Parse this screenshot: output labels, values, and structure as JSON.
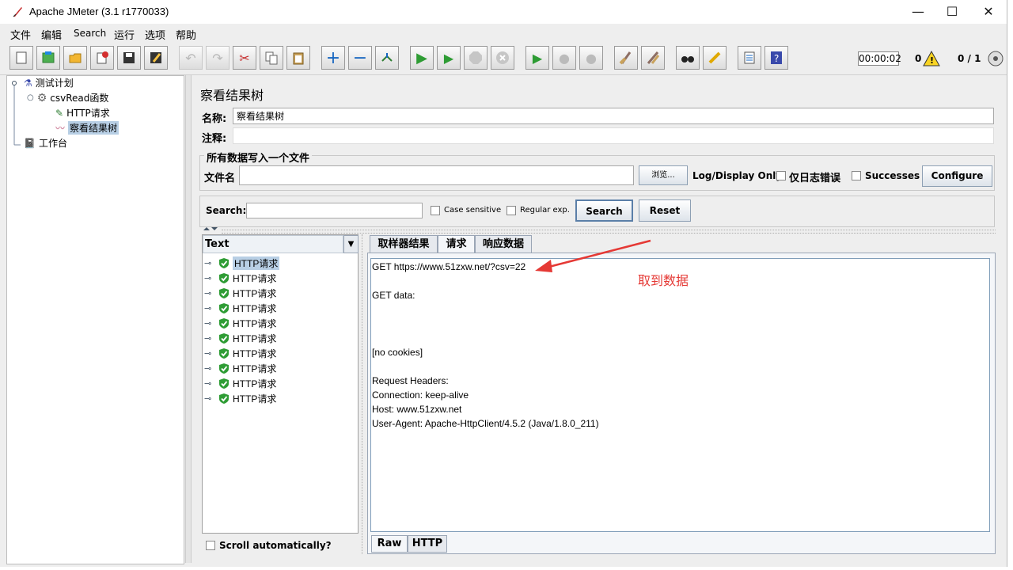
{
  "window": {
    "title": "Apache JMeter (3.1 r1770033)",
    "controls": {
      "minimize": "—",
      "maximize": "☐",
      "close": "✕"
    }
  },
  "menu": [
    "文件",
    "编辑",
    "Search",
    "运行",
    "选项",
    "帮助"
  ],
  "status": {
    "timer": "00:00:02",
    "warnings": "0",
    "threads": "0 / 1"
  },
  "tree": {
    "items": [
      {
        "label": "测试计划",
        "icon": "flask-icon"
      },
      {
        "label": "csvRead函数",
        "icon": "gear-icon"
      },
      {
        "label": "HTTP请求",
        "icon": "pipette-icon"
      },
      {
        "label": "察看结果树",
        "icon": "chart-icon"
      },
      {
        "label": "工作台",
        "icon": "workbench-icon"
      }
    ]
  },
  "panel": {
    "heading": "察看结果树",
    "name_label": "名称:",
    "name_value": "察看结果树",
    "comment_label": "注释:",
    "comment_value": "",
    "file_group_title": "所有数据写入一个文件",
    "file_label": "文件名",
    "file_value": "",
    "browse_label": "浏览...",
    "log_display_label": "Log/Display Only:",
    "errors_only_label": "仅日志错误",
    "successes_label": "Successes",
    "configure_label": "Configure"
  },
  "search": {
    "label": "Search:",
    "value": "",
    "case_sensitive_label": "Case sensitive",
    "regex_label": "Regular exp.",
    "search_button": "Search",
    "reset_button": "Reset"
  },
  "renderer": {
    "selected": "Text"
  },
  "results": [
    "HTTP请求",
    "HTTP请求",
    "HTTP请求",
    "HTTP请求",
    "HTTP请求",
    "HTTP请求",
    "HTTP请求",
    "HTTP请求",
    "HTTP请求",
    "HTTP请求"
  ],
  "scroll_auto_label": "Scroll automatically?",
  "detail_tabs": [
    "取样器结果",
    "请求",
    "响应数据"
  ],
  "request_lines": [
    "GET https://www.51zxw.net/?csv=22",
    "",
    "GET data:",
    "",
    "",
    "",
    "[no cookies]",
    "",
    "Request Headers:",
    "Connection: keep-alive",
    "Host: www.51zxw.net",
    "User-Agent: Apache-HttpClient/4.5.2 (Java/1.8.0_211)"
  ],
  "annotation": {
    "text": "取到数据",
    "color": "#e53935"
  },
  "bottom_tabs": [
    "Raw",
    "HTTP"
  ]
}
